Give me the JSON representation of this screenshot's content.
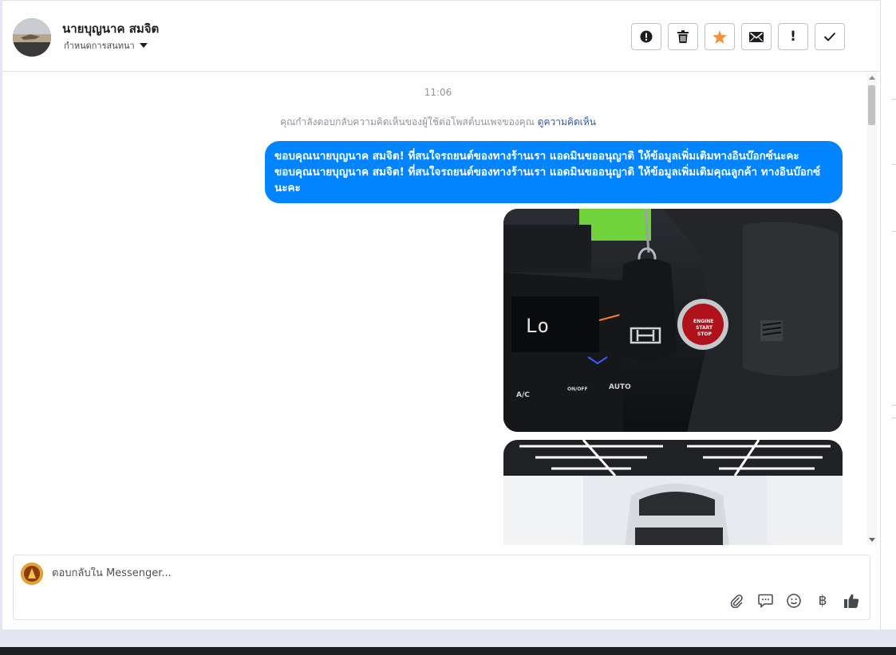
{
  "header": {
    "contact_name": "นายบุญนาค สมจิต",
    "assign_label": "กำหนดการสนทนา"
  },
  "actions": [
    {
      "name": "spam-button",
      "glyph": "!"
    },
    {
      "name": "delete-button",
      "glyph": "🗑"
    },
    {
      "name": "star-button",
      "glyph": "★"
    },
    {
      "name": "mark-unread-button",
      "glyph": "✉"
    },
    {
      "name": "follow-up-button",
      "glyph": "!"
    },
    {
      "name": "done-button",
      "glyph": "✓"
    }
  ],
  "thread": {
    "timestamp": "11:06",
    "notice_text": "คุณกำลังตอบกลับความคิดเห็นของผู้ใช้ต่อโพสต์บนเพจของคุณ",
    "notice_link": "ดูความคิดเห็น",
    "message": "ขอบคุณนายบุญนาค สมจิต! ที่สนใจรถยนต์ของทางร้านเรา แอดมินขออนุญาติ ให้ข้อมูลเพิ่มเติมทางอินบ๊อกซ์นะคะขอบคุณนายบุญนาค สมจิต! ที่สนใจรถยนต์ของทางร้านเรา แอดมินขออนุญาติ ให้ข้อมูลเพิ่มเติมคุณลูกค้า ทางอินบ๊อกซ์นะคะ",
    "photo1_text": {
      "display": "Lo",
      "ac": "A/C",
      "onoff": "ON/OFF",
      "auto": "AUTO",
      "engine_line1": "ENGINE",
      "engine_line2": "START",
      "engine_line3": "STOP"
    }
  },
  "composer": {
    "placeholder": "ตอบกลับใน Messenger...",
    "tools": [
      "paperclip-icon",
      "chat-bubble-icon",
      "smiley-icon",
      "baht-icon",
      "thumbs-up-icon"
    ],
    "baht_glyph": "฿"
  },
  "colors": {
    "accent": "#0084ff",
    "star": "#f7923b",
    "link": "#365899"
  }
}
